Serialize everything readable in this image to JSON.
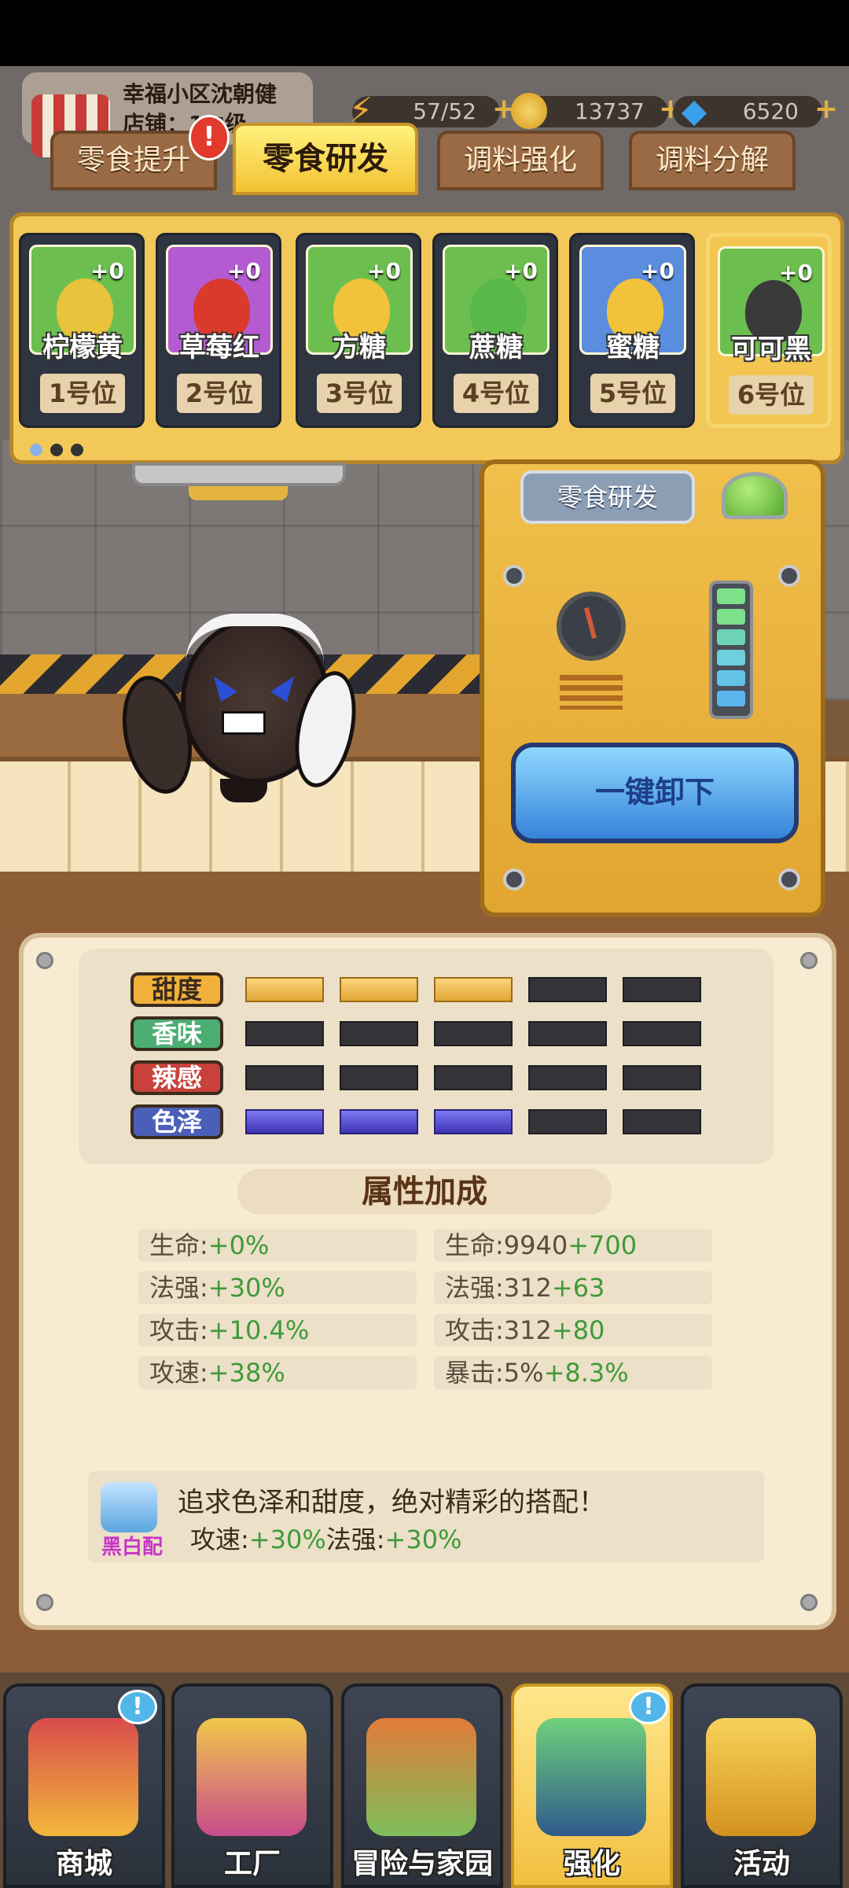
{
  "player": {
    "name": "幸福小区沈朝健",
    "shop": "店铺：1□级"
  },
  "resources": {
    "energy": "57/52",
    "gold": "13737",
    "gems": "6520"
  },
  "tabs": [
    {
      "label": "零食提升"
    },
    {
      "label": "零食研发"
    },
    {
      "label": "调料强化"
    },
    {
      "label": "调料分解"
    }
  ],
  "tab_alert": "!",
  "slots": [
    {
      "name": "柠檬黄",
      "level": "+0",
      "position": "1号位",
      "color": "#6cbf4e",
      "art": "#e9c33c"
    },
    {
      "name": "草莓红",
      "level": "+0",
      "position": "2号位",
      "color": "#b55bd1",
      "art": "#d93a2c"
    },
    {
      "name": "方糖",
      "level": "+0",
      "position": "3号位",
      "color": "#6cbf4e",
      "art": "#f1c23a"
    },
    {
      "name": "蔗糖",
      "level": "+0",
      "position": "4号位",
      "color": "#6cbf4e",
      "art": "#58b94a"
    },
    {
      "name": "蜜糖",
      "level": "+0",
      "position": "5号位",
      "color": "#5b8ddf",
      "art": "#f1c23a"
    },
    {
      "name": "可可黑",
      "level": "+0",
      "position": "6号位",
      "color": "#6cbf4e",
      "art": "#3a3a3a"
    }
  ],
  "machine": {
    "title": "零食研发",
    "unload_button": "一键卸下"
  },
  "stats": [
    {
      "label": "甜度",
      "color": "#f0b03a",
      "filled": 3,
      "fill": "yellow"
    },
    {
      "label": "香味",
      "color": "#4cae72",
      "filled": 0,
      "fill": "none"
    },
    {
      "label": "辣感",
      "color": "#c8423b",
      "filled": 0,
      "fill": "none"
    },
    {
      "label": "色泽",
      "color": "#4b5fb8",
      "filled": 3,
      "fill": "purple"
    }
  ],
  "bonus_title": "属性加成",
  "bonuses": [
    {
      "label": "生命:",
      "value": "+0%"
    },
    {
      "label": "法强:",
      "value": "+30%"
    },
    {
      "label": "攻击:",
      "value": "+10.4%"
    },
    {
      "label": "攻速:",
      "value": "+38%"
    }
  ],
  "totals": [
    {
      "label": "生命:9940",
      "value": "+700"
    },
    {
      "label": "法强:312",
      "value": "+63"
    },
    {
      "label": "攻击:312",
      "value": "+80"
    },
    {
      "label": "暴击:5%",
      "value": "+8.3%"
    }
  ],
  "combo": {
    "name": "黑白配",
    "desc": "追求色泽和甜度，绝对精彩的搭配！",
    "effect_a_label": "攻速:",
    "effect_a_value": "+30%",
    "effect_b_label": "法强:",
    "effect_b_value": "+30%"
  },
  "nav": [
    {
      "label": "商城",
      "badge": "!"
    },
    {
      "label": "工厂",
      "badge": ""
    },
    {
      "label": "冒险与家园",
      "badge": ""
    },
    {
      "label": "强化",
      "badge": "!"
    },
    {
      "label": "活动",
      "badge": ""
    }
  ]
}
